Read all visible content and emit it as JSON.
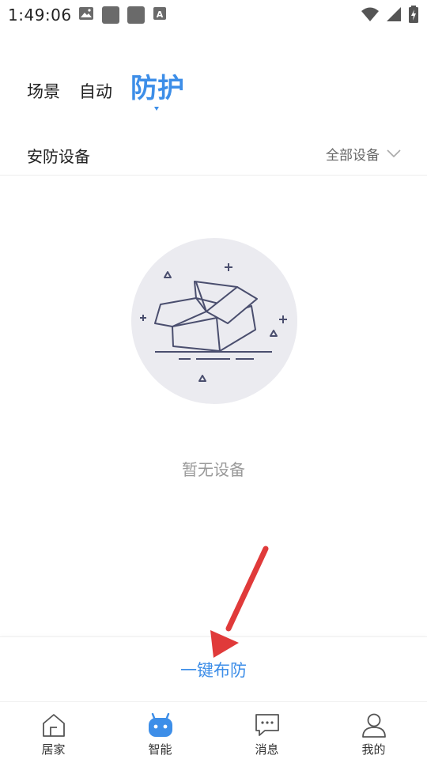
{
  "status_bar": {
    "time": "1:49:06",
    "left_icons": [
      "image-icon",
      "app-icon",
      "app-icon",
      "font-icon"
    ],
    "right_icons": [
      "wifi-icon",
      "signal-icon",
      "battery-charging-icon"
    ]
  },
  "tabs": [
    {
      "label": "场景",
      "active": false
    },
    {
      "label": "自动",
      "active": false
    },
    {
      "label": "防护",
      "active": true
    }
  ],
  "section": {
    "title": "安防设备",
    "filter_label": "全部设备",
    "filter_icon": "chevron-down-icon"
  },
  "empty_state": {
    "icon": "empty-box-icon",
    "text": "暂无设备"
  },
  "arm_button": {
    "label": "一键布防"
  },
  "bottom_nav": [
    {
      "label": "居家",
      "icon": "home-icon",
      "active": false
    },
    {
      "label": "智能",
      "icon": "robot-icon",
      "active": true
    },
    {
      "label": "消息",
      "icon": "message-icon",
      "active": false
    },
    {
      "label": "我的",
      "icon": "profile-icon",
      "active": false
    }
  ],
  "colors": {
    "accent": "#3d8ee8",
    "annotation_arrow": "#e03a3a",
    "empty_circle": "#ebebf0",
    "muted_text": "#9a9a9a"
  }
}
